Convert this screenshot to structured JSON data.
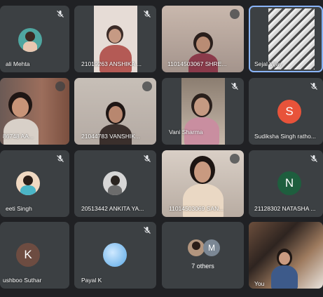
{
  "meeting": {
    "participants": [
      {
        "name": "ali Mehta"
      },
      {
        "name": "21019263 ANSHIKA ..."
      },
      {
        "name": "11014503067 SHRE..."
      },
      {
        "name": "Sejal Vijay"
      },
      {
        "name": "86748 AA..."
      },
      {
        "name": "21044783 VANSHIK..."
      },
      {
        "name": "Vani Sharma"
      },
      {
        "name": "Sudiksha Singh ratho..."
      },
      {
        "name": "eeti Singh"
      },
      {
        "name": "20513442 ANKITA YA..."
      },
      {
        "name": "11014503069 SAN..."
      },
      {
        "name": "21128302 NATASHA ..."
      },
      {
        "name": "ushboo Suthar"
      },
      {
        "name": "Payal K"
      },
      {
        "name": "7 others"
      },
      {
        "name": "You"
      }
    ],
    "avatar_letters": {
      "sudiksha": "S",
      "natasha": "N",
      "khushboo": "K",
      "others_m": "M"
    },
    "colors": {
      "background": "#202124",
      "tile": "#3c4043",
      "active_border": "#8ab4f8",
      "sudiksha_avatar": "#e8533a",
      "natasha_avatar": "#1e5e3e",
      "khushboo_avatar": "#6d4c41",
      "others_m_avatar": "#7b8794"
    }
  }
}
